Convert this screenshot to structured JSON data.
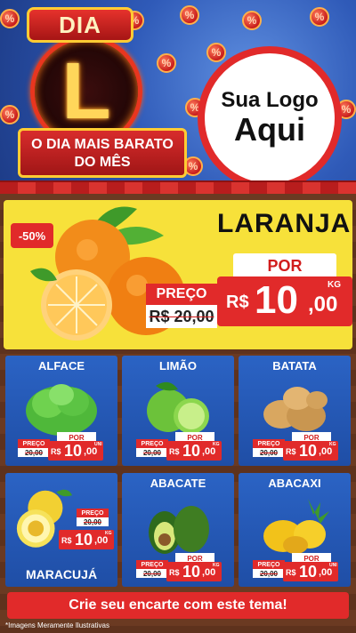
{
  "header": {
    "badge_top": "DIA",
    "badge_letter": "L",
    "ribbon_line1": "O DIA MAIS BARATO",
    "ribbon_line2": "DO MÊS",
    "logo_line1": "Sua Logo",
    "logo_line2": "Aqui",
    "bubble_symbol": "%"
  },
  "hero": {
    "discount": "-50%",
    "title": "LARANJA",
    "por_label": "POR",
    "preco_label": "PREÇO",
    "old_price": "R$ 20,00",
    "currency": "R$",
    "price_int": "10",
    "price_cents": ",00",
    "unit": "KG"
  },
  "products": [
    {
      "name": "ALFACE",
      "preco_label": "PREÇO",
      "old_price": "20,00",
      "por_label": "POR",
      "currency": "R$",
      "price_int": "10",
      "price_cents": ",00",
      "unit": "UNI"
    },
    {
      "name": "LIMÃO",
      "preco_label": "PREÇO",
      "old_price": "20,00",
      "por_label": "POR",
      "currency": "R$",
      "price_int": "10",
      "price_cents": ",00",
      "unit": "KG"
    },
    {
      "name": "BATATA",
      "preco_label": "PREÇO",
      "old_price": "20,00",
      "por_label": "POR",
      "currency": "R$",
      "price_int": "10",
      "price_cents": ",00",
      "unit": "KG"
    },
    {
      "name": "MARACUJÁ",
      "preco_label": "PREÇO",
      "old_price": "20,00",
      "por_label": "POR",
      "currency": "R$",
      "price_int": "10",
      "price_cents": ",00",
      "unit": "KG"
    },
    {
      "name": "ABACATE",
      "preco_label": "PREÇO",
      "old_price": "20,00",
      "por_label": "POR",
      "currency": "R$",
      "price_int": "10",
      "price_cents": ",00",
      "unit": "KG"
    },
    {
      "name": "ABACAXI",
      "preco_label": "PREÇO",
      "old_price": "20,00",
      "por_label": "POR",
      "currency": "R$",
      "price_int": "10",
      "price_cents": ",00",
      "unit": "UNI"
    }
  ],
  "footer": {
    "cta": "Crie seu encarte com este tema!",
    "note": "*Imagens Meramente Ilustrativas"
  },
  "colors": {
    "accent_red": "#e12a2a",
    "hero_yellow": "#f7e13a",
    "card_blue": "#2b63c4"
  }
}
